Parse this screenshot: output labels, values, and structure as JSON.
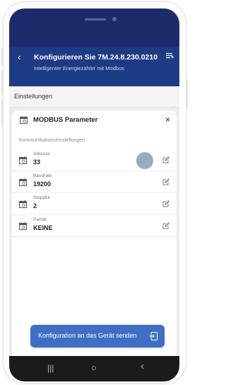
{
  "app": {
    "title": "Konfigurieren Sie 7M.24.8.230.0210",
    "subtitle": "Intelligenter Energiezähler mit Modbus"
  },
  "settings": {
    "label": "Einstellungen"
  },
  "sheet": {
    "title": "MODBUS Parameter",
    "close": "×",
    "section_label": "Kommunikationseinstellungen",
    "rows": [
      {
        "label": "Adresse",
        "value": "33"
      },
      {
        "label": "Baudrate",
        "value": "19200"
      },
      {
        "label": "Stoppbit",
        "value": "2"
      },
      {
        "label": "Parität",
        "value": "KEINE"
      }
    ]
  },
  "send_button": {
    "label": "Konfiguration an das Gerät senden"
  },
  "nav": {
    "recents": "|||",
    "home": "○",
    "back": "‹"
  },
  "icons": {
    "back": "back-arrow-icon",
    "menu": "menu-icon",
    "calendar": "calendar-icon",
    "edit": "edit-icon",
    "close": "close-icon",
    "send": "send-to-device-icon"
  },
  "colors": {
    "status_bar": "#1d2a6b",
    "app_bar": "#1d3b85",
    "button": "#3e6fc4",
    "nav_bar": "#1b1b1b"
  }
}
